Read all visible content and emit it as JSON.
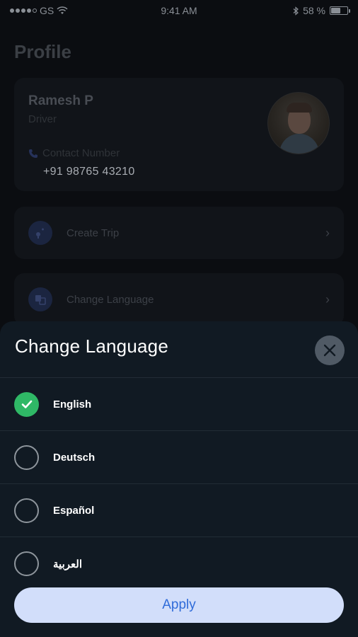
{
  "status_bar": {
    "carrier": "GS",
    "time": "9:41 AM",
    "battery_text": "58 %",
    "battery_level": 0.58
  },
  "profile": {
    "title": "Profile",
    "name": "Ramesh P",
    "role": "Driver",
    "contact_label": "Contact Number",
    "contact_number": "+91 98765 43210"
  },
  "menu": {
    "create_trip": "Create Trip",
    "change_language": "Change Language"
  },
  "sheet": {
    "title": "Change Language",
    "languages": [
      {
        "label": "English",
        "selected": true
      },
      {
        "label": "Deutsch",
        "selected": false
      },
      {
        "label": "Español",
        "selected": false
      },
      {
        "label": "العربية",
        "selected": false
      }
    ],
    "apply_label": "Apply"
  },
  "colors": {
    "accent_green": "#2fb866",
    "apply_bg": "#d2defa",
    "apply_text": "#2f6bd9",
    "sheet_bg": "#111a23"
  },
  "icons": [
    "wifi-icon",
    "bluetooth-icon",
    "battery-icon",
    "phone-icon",
    "route-icon",
    "translate-icon",
    "chevron-right-icon",
    "close-icon",
    "check-icon"
  ]
}
